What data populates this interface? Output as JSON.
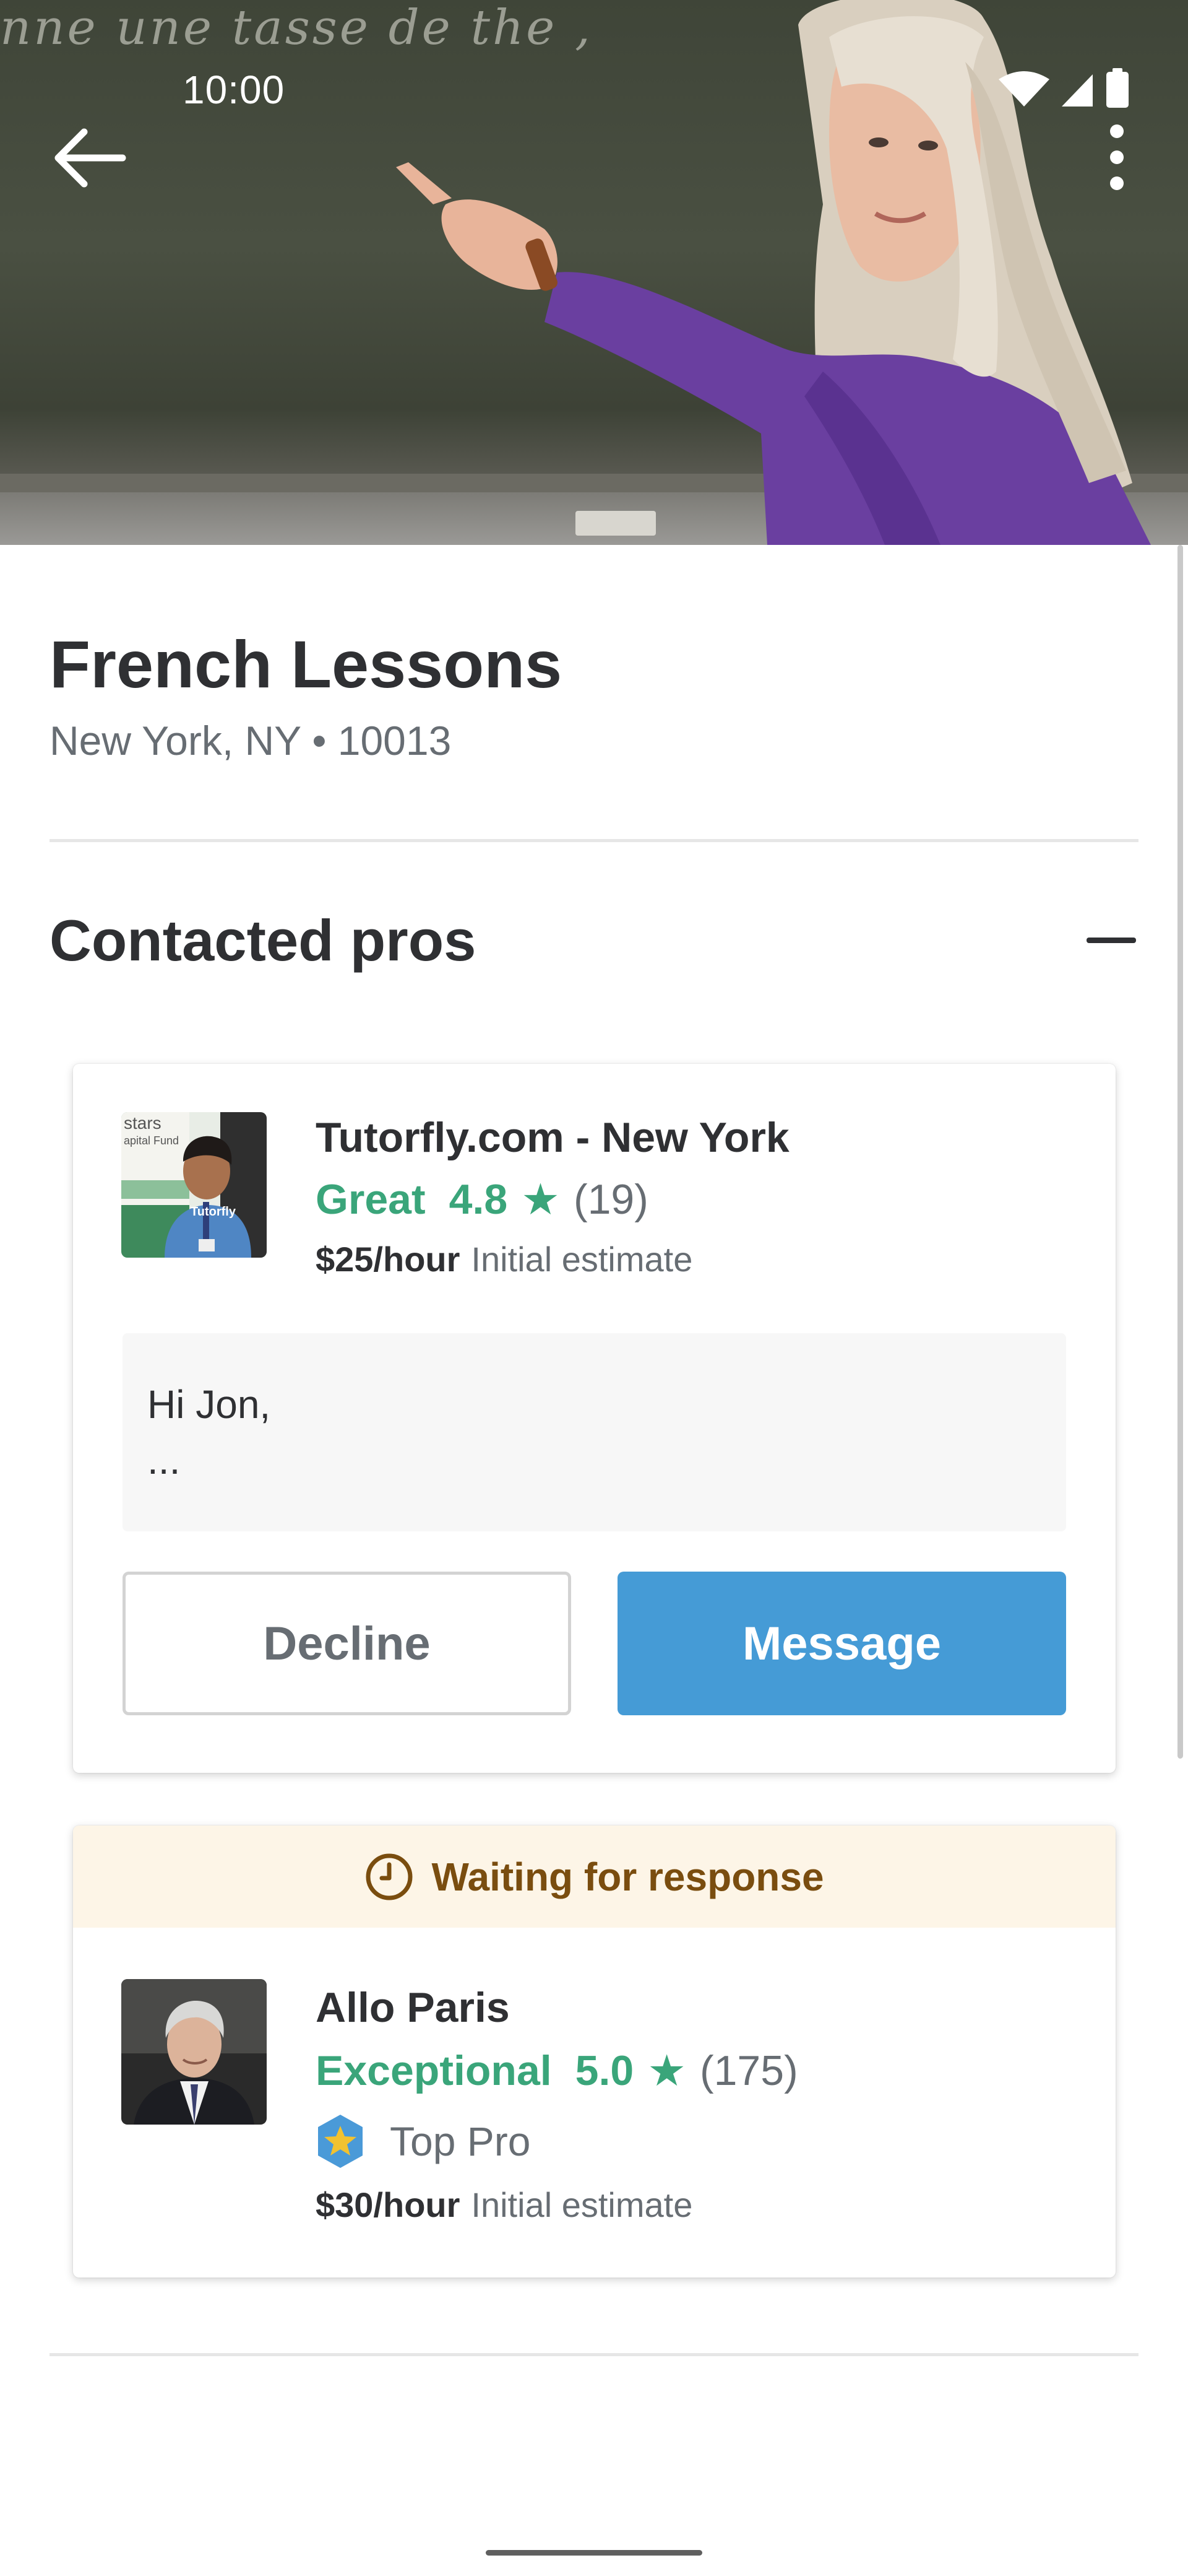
{
  "status_bar": {
    "time": "10:00"
  },
  "hero": {
    "chalkboard_text": "nne une tasse de the ,",
    "back_icon": "arrow-left-icon",
    "more_icon": "more-vertical-icon"
  },
  "request": {
    "title": "French Lessons",
    "location": "New York, NY • 10013"
  },
  "section": {
    "title": "Contacted pros",
    "collapse_icon": "minus-icon"
  },
  "pros": [
    {
      "name": "Tutorfly.com - New York",
      "rating_word": "Great",
      "rating": "4.8",
      "review_count": "(19)",
      "price": "$25/hour",
      "price_note": "Initial estimate",
      "message_line1": "Hi Jon,",
      "message_line2": "...",
      "decline_label": "Decline",
      "message_label": "Message",
      "avatar_text1": "stars",
      "avatar_text2": "apital Fund",
      "avatar_text3": "Tutorfly"
    },
    {
      "status": "Waiting for response",
      "name": "Allo Paris",
      "rating_word": "Exceptional",
      "rating": "5.0",
      "review_count": "(175)",
      "badge": "Top Pro",
      "price": "$30/hour",
      "price_note": "Initial estimate"
    }
  ],
  "colors": {
    "rating_green": "#3aa57a",
    "message_button_blue": "#459bd6",
    "waiting_banner_bg": "#fdf5e7",
    "waiting_text": "#7a4d0f",
    "top_pro_badge": "#4a9ad8",
    "top_pro_star": "#f2c230"
  }
}
